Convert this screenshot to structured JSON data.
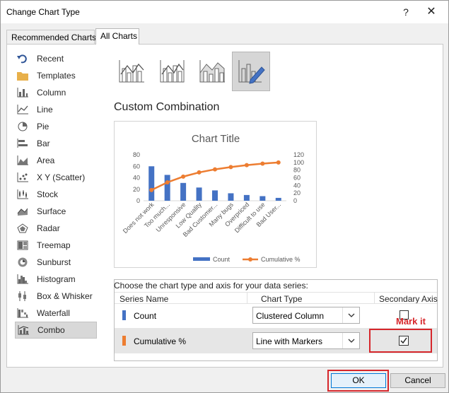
{
  "window": {
    "title": "Change Chart Type",
    "help_label": "?",
    "close_label": "✕"
  },
  "tabs": [
    {
      "label": "Recommended Charts",
      "selected": false
    },
    {
      "label": "All Charts",
      "selected": true
    }
  ],
  "sidebar": {
    "items": [
      {
        "label": "Recent",
        "icon": "undo-arrow-icon"
      },
      {
        "label": "Templates",
        "icon": "folder-icon"
      },
      {
        "label": "Column",
        "icon": "column-chart-icon"
      },
      {
        "label": "Line",
        "icon": "line-chart-icon"
      },
      {
        "label": "Pie",
        "icon": "pie-chart-icon"
      },
      {
        "label": "Bar",
        "icon": "bar-chart-icon"
      },
      {
        "label": "Area",
        "icon": "area-chart-icon"
      },
      {
        "label": "X Y (Scatter)",
        "icon": "scatter-chart-icon"
      },
      {
        "label": "Stock",
        "icon": "stock-chart-icon"
      },
      {
        "label": "Surface",
        "icon": "surface-chart-icon"
      },
      {
        "label": "Radar",
        "icon": "radar-chart-icon"
      },
      {
        "label": "Treemap",
        "icon": "treemap-chart-icon"
      },
      {
        "label": "Sunburst",
        "icon": "sunburst-chart-icon"
      },
      {
        "label": "Histogram",
        "icon": "histogram-chart-icon"
      },
      {
        "label": "Box & Whisker",
        "icon": "box-whisker-chart-icon"
      },
      {
        "label": "Waterfall",
        "icon": "waterfall-chart-icon"
      },
      {
        "label": "Combo",
        "icon": "combo-chart-icon",
        "selected": true
      }
    ]
  },
  "subtypes": [
    {
      "name": "clustered-column-line",
      "selected": false
    },
    {
      "name": "clustered-column-line-secondary-axis",
      "selected": false
    },
    {
      "name": "stacked-area-clustered-column",
      "selected": false
    },
    {
      "name": "custom-combination",
      "selected": true
    }
  ],
  "section_title": "Custom Combination",
  "chart_data": {
    "type": "bar",
    "title": "Chart Title",
    "categories": [
      "Does not work",
      "Too much...",
      "Unresponsive",
      "Low Quality",
      "Bad Customer...",
      "Many bugs",
      "Overpriced",
      "Difficult to use",
      "Bad User..."
    ],
    "series": [
      {
        "name": "Count",
        "type": "bar",
        "axis": "primary",
        "color": "#4472c4",
        "values": [
          60,
          45,
          31,
          23,
          18,
          13,
          10,
          8,
          5
        ]
      },
      {
        "name": "Cumulative %",
        "type": "line",
        "axis": "secondary",
        "color": "#ed7d31",
        "values": [
          28,
          48,
          63,
          74,
          82,
          88,
          93,
          97,
          100
        ]
      }
    ],
    "primary_axis": {
      "ticks": [
        "0",
        "20",
        "40",
        "60",
        "80"
      ],
      "ylim": [
        0,
        80
      ]
    },
    "secondary_axis": {
      "ticks": [
        "0",
        "20",
        "40",
        "60",
        "80",
        "100",
        "120"
      ],
      "ylim": [
        0,
        120
      ]
    },
    "legend": {
      "position": "bottom",
      "entries": [
        "Count",
        "Cumulative %"
      ]
    },
    "grid": false
  },
  "series_panel": {
    "caption": "Choose the chart type and axis for your data series:",
    "headers": {
      "series_name": "Series Name",
      "chart_type": "Chart Type",
      "secondary_axis": "Secondary Axis"
    },
    "rows": [
      {
        "name": "Count",
        "color": "#4472c4",
        "chart_type": "Clustered Column",
        "secondary_axis": false
      },
      {
        "name": "Cumulative %",
        "color": "#ed7d31",
        "chart_type": "Line with Markers",
        "secondary_axis": true
      }
    ]
  },
  "annotation": {
    "text": "Mark it",
    "color": "#d6262b"
  },
  "buttons": {
    "ok": "OK",
    "cancel": "Cancel"
  }
}
